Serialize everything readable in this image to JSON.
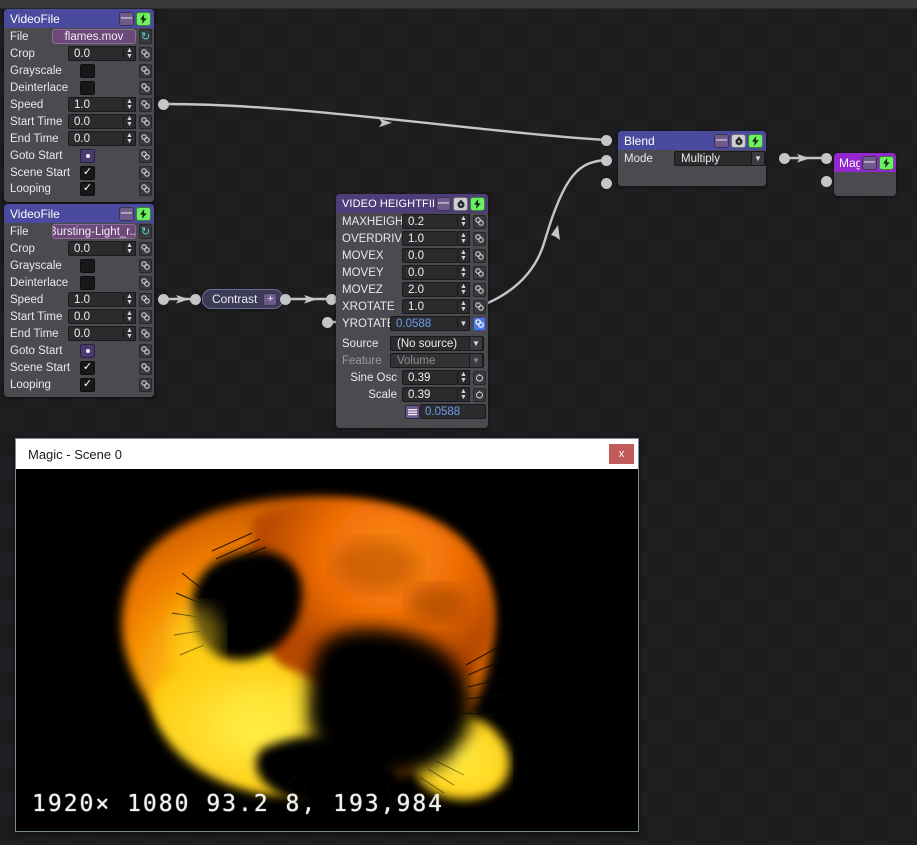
{
  "app": {
    "window_title": "Magic - Scene 0",
    "close_label": "x"
  },
  "nodes": {
    "videofile1": {
      "title": "VideoFile",
      "buttons": {
        "minimize": "—",
        "bolt": "bolt-icon"
      },
      "rows": [
        {
          "label": "File",
          "type": "file",
          "value": "flames.mov",
          "refresh": "refresh-icon"
        },
        {
          "label": "Crop",
          "type": "number",
          "value": "0.0"
        },
        {
          "label": "Grayscale",
          "type": "checkbox",
          "value": ""
        },
        {
          "label": "Deinterlace",
          "type": "checkbox",
          "value": ""
        },
        {
          "label": "Speed",
          "type": "number",
          "value": "1.0"
        },
        {
          "label": "Start Time",
          "type": "number",
          "value": "0.0"
        },
        {
          "label": "End Time",
          "type": "number",
          "value": "0.0"
        },
        {
          "label": "Goto Start",
          "type": "radio",
          "value": ""
        },
        {
          "label": "Scene Start",
          "type": "checkbox",
          "value": "✓"
        },
        {
          "label": "Looping",
          "type": "checkbox",
          "value": "✓"
        }
      ]
    },
    "videofile2": {
      "title": "VideoFile",
      "buttons": {
        "minimize": "—",
        "bolt": "bolt-icon"
      },
      "rows": [
        {
          "label": "File",
          "type": "file",
          "value": "Bursting-Light_r...",
          "refresh": "refresh-icon"
        },
        {
          "label": "Crop",
          "type": "number",
          "value": "0.0"
        },
        {
          "label": "Grayscale",
          "type": "checkbox",
          "value": ""
        },
        {
          "label": "Deinterlace",
          "type": "checkbox",
          "value": ""
        },
        {
          "label": "Speed",
          "type": "number",
          "value": "1.0"
        },
        {
          "label": "Start Time",
          "type": "number",
          "value": "0.0"
        },
        {
          "label": "End Time",
          "type": "number",
          "value": "0.0"
        },
        {
          "label": "Goto Start",
          "type": "radio",
          "value": ""
        },
        {
          "label": "Scene Start",
          "type": "checkbox",
          "value": "✓"
        },
        {
          "label": "Looping",
          "type": "checkbox",
          "value": "✓"
        }
      ]
    },
    "contrast": {
      "title": "Contrast",
      "expand": "+"
    },
    "heightfield": {
      "title": "VIDEO HEIGHTFIELD+",
      "buttons": {
        "minimize": "—",
        "clock": "clock-icon",
        "bolt": "bolt-icon"
      },
      "rows": [
        {
          "label": "MAXHEIGHT",
          "value": "0.2"
        },
        {
          "label": "OVERDRIVE",
          "value": "1.0"
        },
        {
          "label": "MOVEX",
          "value": "0.0"
        },
        {
          "label": "MOVEY",
          "value": "0.0"
        },
        {
          "label": "MOVEZ",
          "value": "2.0"
        },
        {
          "label": "XROTATE",
          "value": "1.0"
        },
        {
          "label": "YROTATE",
          "value": "0.0588",
          "highlighted": true
        }
      ],
      "modulation": {
        "source_label": "Source",
        "source_value": "(No source)",
        "feature_label": "Feature",
        "feature_value": "Volume",
        "sine_label": "Sine Osc",
        "sine_value": "0.39",
        "scale_label": "Scale",
        "scale_value": "0.39",
        "result_value": "0.0588",
        "result_icon": "equalizer-icon"
      }
    },
    "blend": {
      "title": "Blend",
      "buttons": {
        "minimize": "—",
        "clock": "clock-icon",
        "bolt": "bolt-icon"
      },
      "mode_label": "Mode",
      "mode_value": "Multiply"
    },
    "magic": {
      "title": "Magic",
      "buttons": {
        "minimize": "—",
        "bolt": "bolt-icon"
      }
    }
  },
  "overlay": {
    "osd_text": "1920× 1080  93.2  8, 193,984"
  },
  "colors": {
    "accent_header": "#4a4a9e",
    "magic_header": "#9226cf",
    "heightfield_header": "#4d3d79",
    "bolt_green": "#6ff064",
    "link_active": "#4f78d6",
    "value_blue": "#6d9eeb",
    "close_red": "#c35b5b"
  }
}
